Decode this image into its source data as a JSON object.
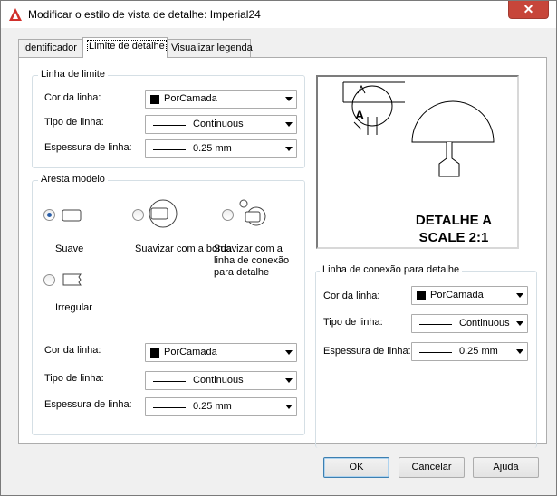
{
  "window": {
    "title": "Modificar o estilo de vista de detalhe: Imperial24",
    "close_label": "✕"
  },
  "tabs": [
    {
      "label": "Identificador"
    },
    {
      "label": "Limite de detalhe"
    },
    {
      "label": "Visualizar legenda"
    }
  ],
  "boundary": {
    "title": "Linha de limite",
    "color_label": "Cor da linha:",
    "color_value": "PorCamada",
    "type_label": "Tipo de linha:",
    "type_value": "Continuous",
    "weight_label": "Espessura de linha:",
    "weight_value": "0.25 mm"
  },
  "model_edge": {
    "title": "Aresta modelo",
    "options": [
      {
        "label": "Suave",
        "checked": true
      },
      {
        "label": "Suavizar com a borda",
        "checked": false
      },
      {
        "label": "Suavizar com a linha de conexão para detalhe",
        "checked": false
      },
      {
        "label": "Irregular",
        "checked": false
      }
    ],
    "color_label": "Cor da linha:",
    "color_value": "PorCamada",
    "type_label": "Tipo de linha:",
    "type_value": "Continuous",
    "weight_label": "Espessura de linha:",
    "weight_value": "0.25 mm"
  },
  "preview": {
    "marker_letter": "A",
    "caption_line1": "DETALHE A",
    "caption_line2": "SCALE 2:1"
  },
  "connection": {
    "title": "Linha de conexão para detalhe",
    "color_label": "Cor da linha:",
    "color_value": "PorCamada",
    "type_label": "Tipo de linha:",
    "type_value": "Continuous",
    "weight_label": "Espessura de linha:",
    "weight_value": "0.25 mm"
  },
  "buttons": {
    "ok": "OK",
    "cancel": "Cancelar",
    "help": "Ajuda"
  },
  "colors": {
    "accent": "#c7463a",
    "app_icon": "#d0302c"
  }
}
